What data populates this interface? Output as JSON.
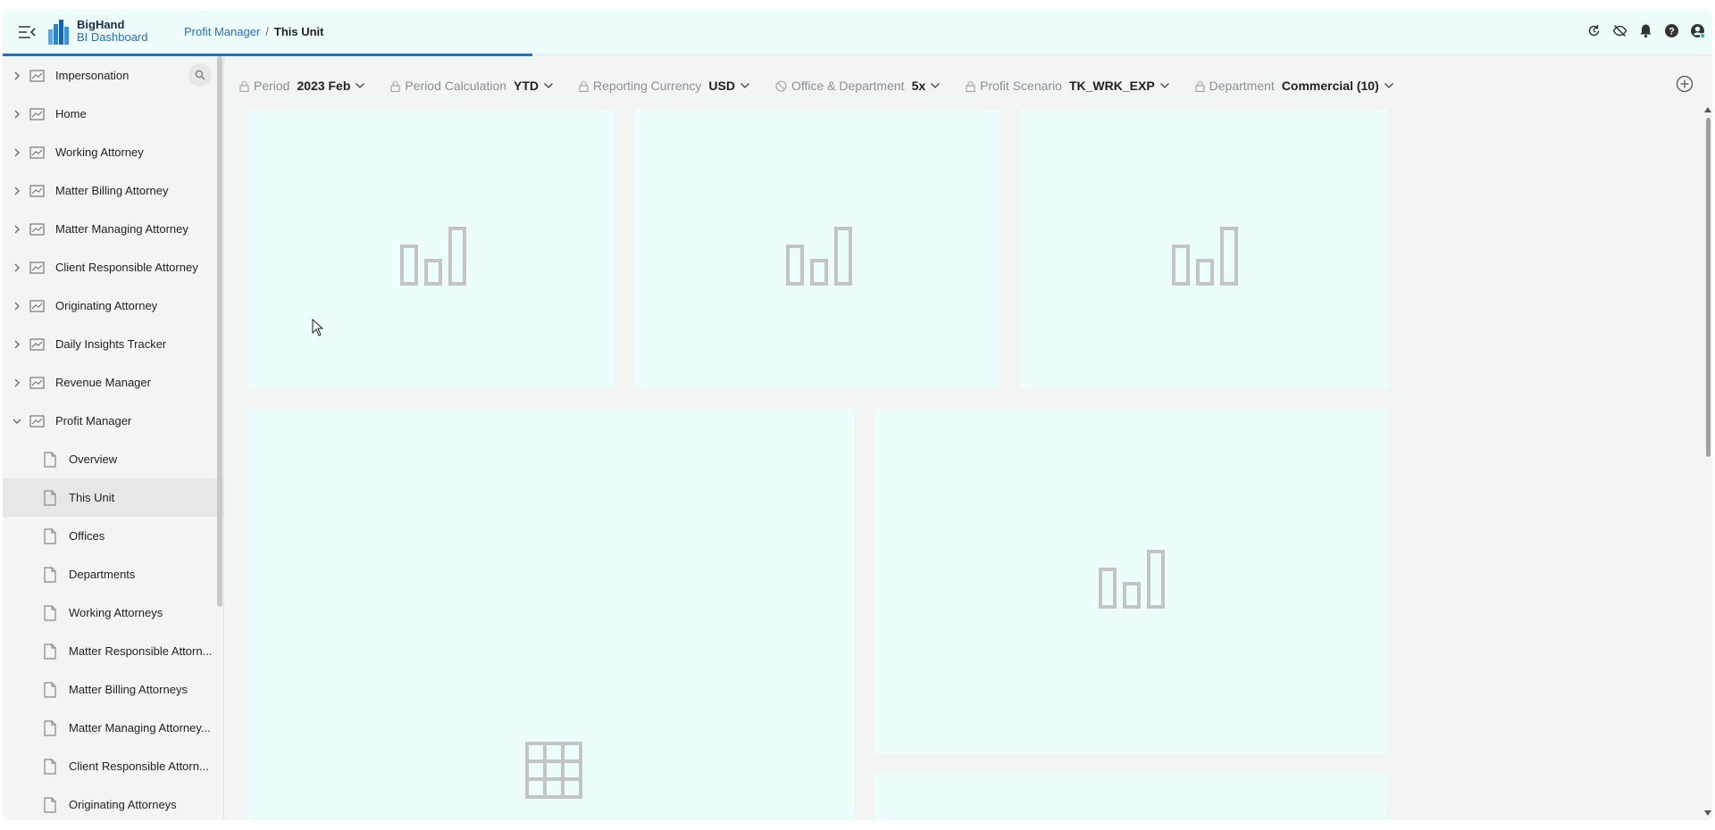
{
  "header": {
    "brand_name": "BigHand",
    "brand_sub": "BI Dashboard",
    "breadcrumb": {
      "parent": "Profit Manager",
      "separator": "/",
      "current": "This Unit"
    },
    "icons": [
      "refresh-icon",
      "eye-off-icon",
      "bell-icon",
      "help-icon",
      "user-icon"
    ]
  },
  "sidebar": {
    "items": [
      {
        "label": "Impersonation",
        "expanded": false
      },
      {
        "label": "Home",
        "expanded": false
      },
      {
        "label": "Working Attorney",
        "expanded": false
      },
      {
        "label": "Matter Billing Attorney",
        "expanded": false
      },
      {
        "label": "Matter Managing Attorney",
        "expanded": false
      },
      {
        "label": "Client Responsible Attorney",
        "expanded": false
      },
      {
        "label": "Originating Attorney",
        "expanded": false
      },
      {
        "label": "Daily Insights Tracker",
        "expanded": false
      },
      {
        "label": "Revenue Manager",
        "expanded": false
      },
      {
        "label": "Profit Manager",
        "expanded": true
      }
    ],
    "sub_items": [
      {
        "label": "Overview",
        "active": false
      },
      {
        "label": "This Unit",
        "active": true
      },
      {
        "label": "Offices",
        "active": false
      },
      {
        "label": "Departments",
        "active": false
      },
      {
        "label": "Working Attorneys",
        "active": false
      },
      {
        "label": "Matter Responsible Attorn...",
        "active": false
      },
      {
        "label": "Matter Billing Attorneys",
        "active": false
      },
      {
        "label": "Matter Managing Attorney...",
        "active": false
      },
      {
        "label": "Client Responsible Attorn...",
        "active": false
      },
      {
        "label": "Originating Attorneys",
        "active": false
      }
    ]
  },
  "filters": [
    {
      "name": "Period",
      "value": "2023 Feb",
      "icon": "lock-icon"
    },
    {
      "name": "Period Calculation",
      "value": "YTD",
      "icon": "lock-icon"
    },
    {
      "name": "Reporting Currency",
      "value": "USD",
      "icon": "lock-icon"
    },
    {
      "name": "Office & Department",
      "value": "5x",
      "icon": "block-icon"
    },
    {
      "name": "Profit Scenario",
      "value": "TK_WRK_EXP",
      "icon": "lock-icon"
    },
    {
      "name": "Department",
      "value": "Commercial (10)",
      "icon": "lock-icon"
    }
  ],
  "colors": {
    "accent": "#1f6fce",
    "header_bg": "#eefcfc",
    "tile_bg": "#ebfdfd",
    "placeholder_icon": "#c4c4c4"
  }
}
